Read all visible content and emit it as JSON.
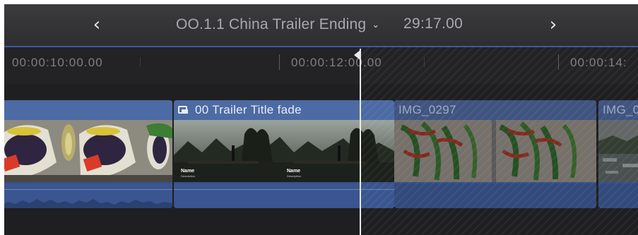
{
  "header": {
    "back_icon": "chevron-left-icon",
    "back_glyph": "‹",
    "project_title": "OO.1.1 China Trailer Ending",
    "dropdown_icon": "chevron-down-icon",
    "dropdown_glyph": "⌄",
    "duration": "29:17.00",
    "forward_icon": "chevron-right-icon",
    "forward_glyph": "›"
  },
  "ruler": {
    "timecodes": [
      "00:00:10:00.00",
      "00:00:12:00.00",
      "00:00:14:"
    ]
  },
  "clips": [
    {
      "name": "",
      "type": "video",
      "thumbnail": "grapes-and-peppers-market"
    },
    {
      "name": "00 Trailer Title fade",
      "type": "title",
      "icon": "title-clip-icon",
      "thumbnail": "river-boatman-karst",
      "overlay_text": "Name",
      "overlay_subtext": "Description"
    },
    {
      "name": "IMG_0297",
      "type": "video",
      "thumbnail": "green-and-red-chili-peppers"
    },
    {
      "name": "IMG_0",
      "type": "video",
      "thumbnail": "river-boats-town"
    }
  ],
  "colors": {
    "accent": "#3b59a8",
    "clip_body": "#36518a",
    "clip_header": "#4c6aa4",
    "playhead": "#e9e9e9"
  }
}
